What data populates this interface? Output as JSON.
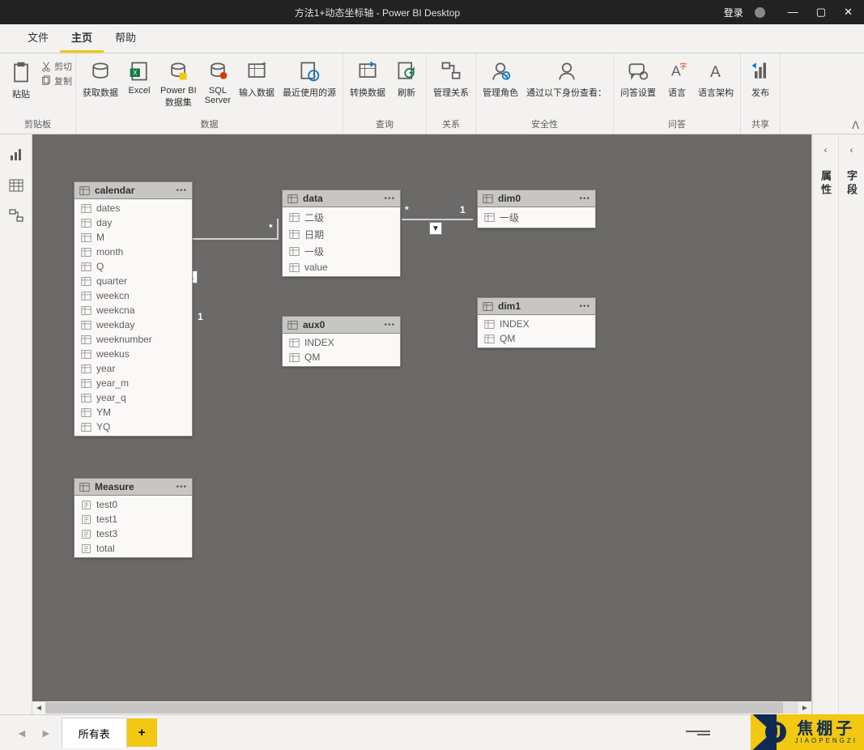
{
  "titlebar": {
    "title": "方法1+动态坐标轴 - Power BI Desktop",
    "login": "登录"
  },
  "menutabs": {
    "file": "文件",
    "home": "主页",
    "help": "帮助"
  },
  "ribbon": {
    "clipboard": {
      "paste": "粘贴",
      "cut": "剪切",
      "copy": "复制",
      "group": "剪贴板"
    },
    "data": {
      "getdata": "获取数据",
      "excel": "Excel",
      "pbi": "Power BI\n数据集",
      "sql": "SQL\nServer",
      "enter": "输入数据",
      "recent": "最近使用的源",
      "group": "数据"
    },
    "query": {
      "transform": "转换数据",
      "refresh": "刷新",
      "group": "查询"
    },
    "rel": {
      "manage": "管理关系",
      "group": "关系"
    },
    "sec": {
      "roles": "管理角色",
      "viewas": "通过以下身份查看：",
      "group": "安全性"
    },
    "qa": {
      "setup": "问答设置",
      "lang": "语言",
      "schema": "语言架构",
      "group": "问答"
    },
    "share": {
      "publish": "发布",
      "group": "共享"
    }
  },
  "rightpanes": {
    "p1": "属性",
    "p2": "字段"
  },
  "tables": {
    "calendar": {
      "name": "calendar",
      "fields": [
        "dates",
        "day",
        "M",
        "month",
        "Q",
        "quarter",
        "weekcn",
        "weekcna",
        "weekday",
        "weeknumber",
        "weekus",
        "year",
        "year_m",
        "year_q",
        "YM",
        "YQ"
      ]
    },
    "measure": {
      "name": "Measure",
      "fields": [
        "test0",
        "test1",
        "test3",
        "total"
      ]
    },
    "data": {
      "name": "data",
      "fields": [
        "二级",
        "日期",
        "一级",
        "value"
      ]
    },
    "aux0": {
      "name": "aux0",
      "fields": [
        "INDEX",
        "QM"
      ]
    },
    "dim0": {
      "name": "dim0",
      "fields": [
        "一级"
      ]
    },
    "dim1": {
      "name": "dim1",
      "fields": [
        "INDEX",
        "QM"
      ]
    }
  },
  "rel_labels": {
    "one_a": "1",
    "one_b": "1",
    "star": "*"
  },
  "footer": {
    "sheet": "所有表"
  },
  "watermark": {
    "brand": "焦棚子",
    "sub": "JIAOPENGZI",
    "j": "J"
  }
}
